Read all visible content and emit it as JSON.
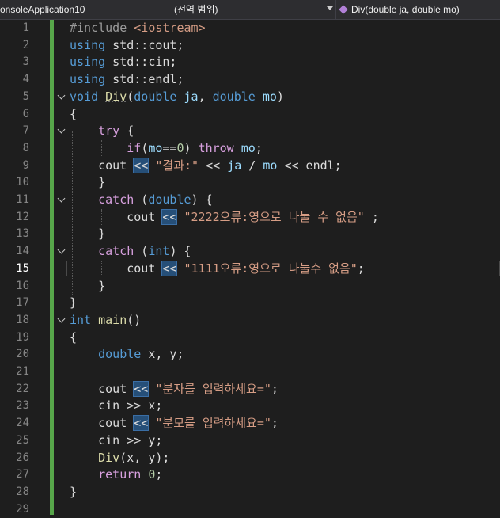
{
  "navbar": {
    "project": "onsoleApplication10",
    "scope": "(전역 범위)",
    "member": "Div(double ja, double mo)"
  },
  "colors": {
    "background": "#1e1e1e",
    "keyword": "#569cd6",
    "control": "#d8a0df",
    "string": "#d69d85",
    "function": "#dcdcaa",
    "number": "#b5cea8",
    "parameter": "#9cdcfe",
    "change_bar": "#57a64a"
  },
  "current_line": 15,
  "lines": [
    {
      "n": "1"
    },
    {
      "n": "2"
    },
    {
      "n": "3"
    },
    {
      "n": "4"
    },
    {
      "n": "5"
    },
    {
      "n": "6"
    },
    {
      "n": "7"
    },
    {
      "n": "8"
    },
    {
      "n": "9"
    },
    {
      "n": "10"
    },
    {
      "n": "11"
    },
    {
      "n": "12"
    },
    {
      "n": "13"
    },
    {
      "n": "14"
    },
    {
      "n": "15"
    },
    {
      "n": "16"
    },
    {
      "n": "17"
    },
    {
      "n": "18"
    },
    {
      "n": "19"
    },
    {
      "n": "20"
    },
    {
      "n": "21"
    },
    {
      "n": "22"
    },
    {
      "n": "23"
    },
    {
      "n": "24"
    },
    {
      "n": "25"
    },
    {
      "n": "26"
    },
    {
      "n": "27"
    },
    {
      "n": "28"
    },
    {
      "n": "29"
    }
  ],
  "code": {
    "l1": {
      "a": "#include ",
      "b": "<iostream>"
    },
    "l2": {
      "a": "using",
      "b": " std::cout;"
    },
    "l3": {
      "a": "using",
      "b": " std::cin;"
    },
    "l4": {
      "a": "using",
      "b": " std::endl;"
    },
    "l5": {
      "a": "void",
      "b": " ",
      "c": "Div",
      "d": "(",
      "e": "double",
      "f": " ",
      "g": "ja",
      "h": ", ",
      "i": "double",
      "j": " ",
      "k": "mo",
      "l": ")"
    },
    "l6": {
      "a": "{"
    },
    "l7": {
      "a": "    ",
      "b": "try",
      "c": " {"
    },
    "l8": {
      "a": "        ",
      "b": "if",
      "c": "(",
      "d": "mo",
      "e": "==",
      "f": "0",
      "g": ") ",
      "h": "throw",
      "i": " ",
      "j": "mo",
      "k": ";"
    },
    "l9": {
      "a": "    cout ",
      "b": "<<",
      "c": " ",
      "d": "\"결과:\"",
      "e": " << ",
      "f": "ja",
      "g": " / ",
      "h": "mo",
      "i": " << endl;"
    },
    "l10": {
      "a": "    }"
    },
    "l11": {
      "a": "    ",
      "b": "catch",
      "c": " (",
      "d": "double",
      "e": ") {"
    },
    "l12": {
      "a": "        cout ",
      "b": "<<",
      "c": " ",
      "d": "\"2222오류:영으로 나눌 수 없음\"",
      "e": " ;"
    },
    "l13": {
      "a": "    }"
    },
    "l14": {
      "a": "    ",
      "b": "catch",
      "c": " (",
      "d": "int",
      "e": ") {"
    },
    "l15": {
      "a": "        cout ",
      "b": "<<",
      "c": " ",
      "d": "\"1111오류:영으로 나눌수 없음\"",
      "e": ";"
    },
    "l16": {
      "a": "    }"
    },
    "l17": {
      "a": "}"
    },
    "l18": {
      "a": "int",
      "b": " ",
      "c": "main",
      "d": "()"
    },
    "l19": {
      "a": "{"
    },
    "l20": {
      "a": "    ",
      "b": "double",
      "c": " x, y;"
    },
    "l21": {
      "a": ""
    },
    "l22": {
      "a": "    cout ",
      "b": "<<",
      "c": " ",
      "d": "\"분자를 입력하세요=\"",
      "e": ";"
    },
    "l23": {
      "a": "    cin >> x;"
    },
    "l24": {
      "a": "    cout ",
      "b": "<<",
      "c": " ",
      "d": "\"분모를 입력하세요=\"",
      "e": ";"
    },
    "l25": {
      "a": "    cin >> y;"
    },
    "l26": {
      "a": "    ",
      "b": "Div",
      "c": "(x, y);"
    },
    "l27": {
      "a": "    ",
      "b": "return",
      "c": " ",
      "d": "0",
      "e": ";"
    },
    "l28": {
      "a": "}"
    },
    "l29": {
      "a": ""
    }
  }
}
